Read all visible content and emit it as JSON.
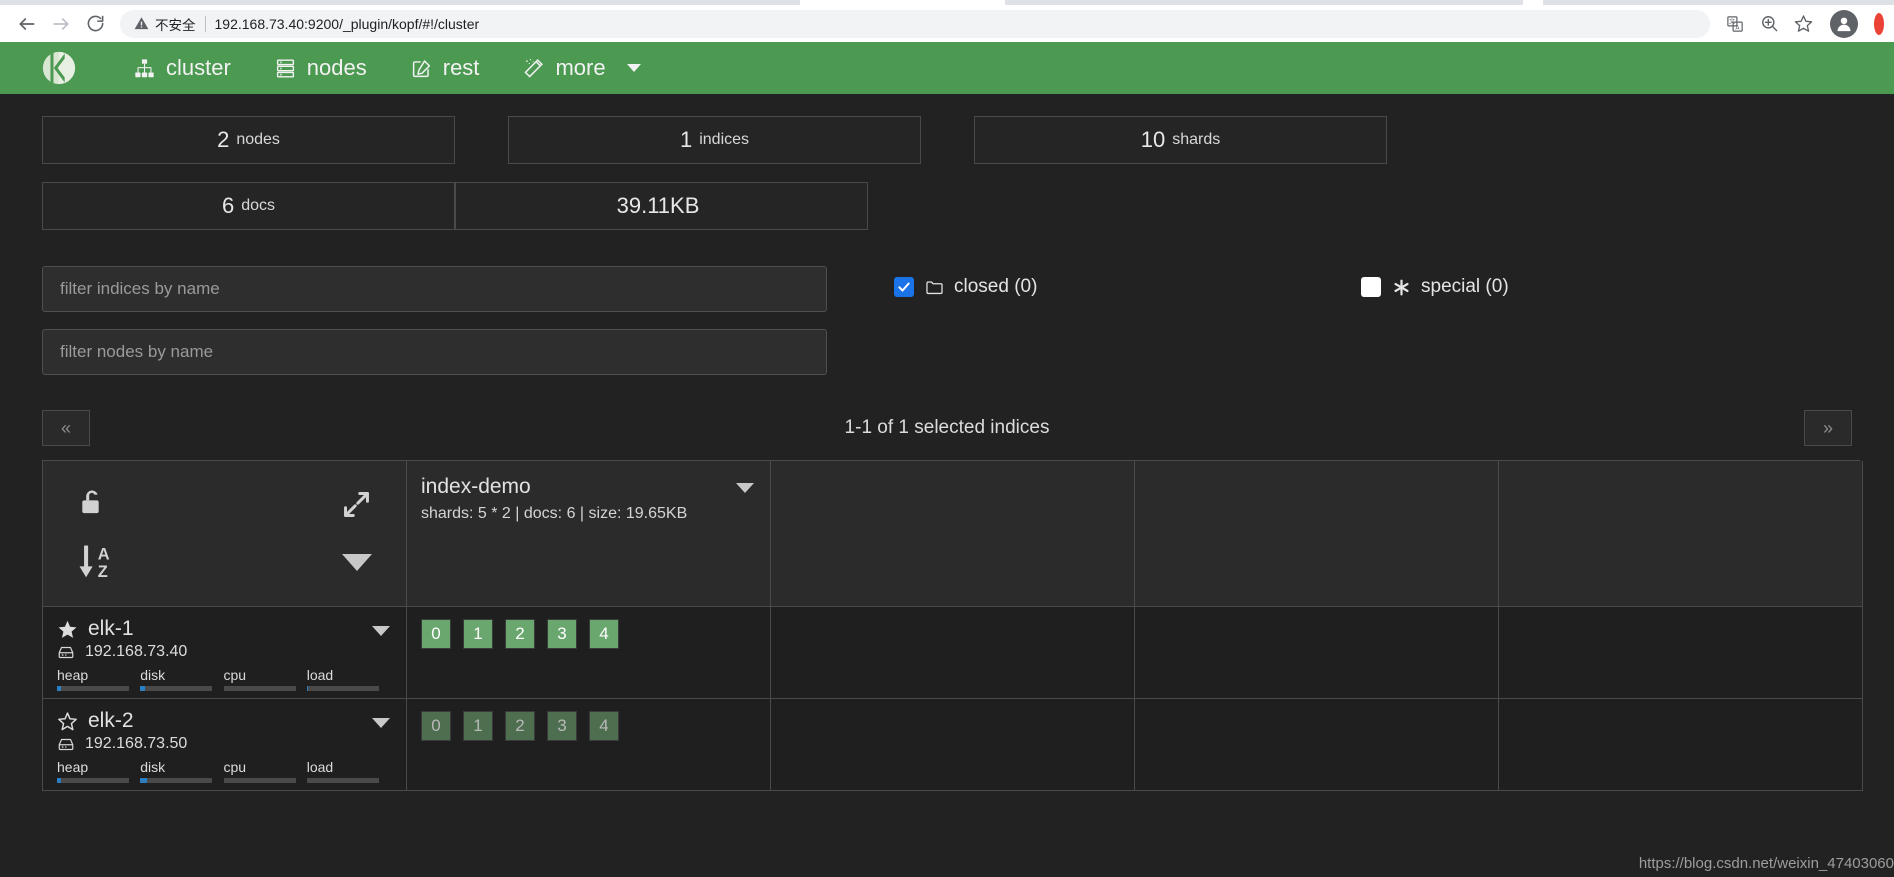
{
  "browser": {
    "back_icon": "back-arrow-icon",
    "forward_icon": "forward-arrow-icon",
    "reload_icon": "reload-icon",
    "security_label": "不安全",
    "url": "192.168.73.40:9200/_plugin/kopf/#!/cluster",
    "actions": [
      "translate-icon",
      "zoom-icon",
      "bookmark-star-icon",
      "profile-avatar-icon"
    ]
  },
  "app_nav": {
    "brand": "kopf-logo",
    "items": [
      {
        "label": "cluster",
        "icon": "sitemap-icon"
      },
      {
        "label": "nodes",
        "icon": "server-stack-icon"
      },
      {
        "label": "rest",
        "icon": "edit-square-icon"
      },
      {
        "label": "more",
        "icon": "magic-wand-icon",
        "caret": true
      }
    ]
  },
  "stats": [
    {
      "value": "2",
      "unit": "nodes"
    },
    {
      "value": "1",
      "unit": "indices"
    },
    {
      "value": "10",
      "unit": "shards"
    },
    {
      "value": "6",
      "unit": "docs"
    },
    {
      "value": "39.11KB",
      "unit": ""
    }
  ],
  "filters": {
    "indices_placeholder": "filter indices by name",
    "indices_value": "",
    "nodes_placeholder": "filter nodes by name",
    "nodes_value": "",
    "toggles": [
      {
        "label": "closed (0)",
        "checked": true,
        "icon": "folder-icon"
      },
      {
        "label": "special (0)",
        "checked": false,
        "icon": "asterisk-icon"
      }
    ]
  },
  "pager": {
    "prev": "«",
    "next": "»",
    "label": "1-1 of 1 selected indices"
  },
  "grid": {
    "controls": {
      "lock_icon": "unlock-icon",
      "expand_icon": "expand-arrows-icon",
      "sort_icon": "sort-alpha-asc-icon",
      "menu_icon": "caret-down-icon"
    },
    "indices": [
      {
        "name": "index-demo",
        "meta": "shards: 5 * 2 | docs: 6 | size: 19.65KB",
        "menu_icon": "caret-down-icon"
      }
    ],
    "empty_columns": 3,
    "nodes": [
      {
        "name": "elk-1",
        "ip": "192.168.73.40",
        "star": "star-filled-icon",
        "master": true,
        "menu_icon": "caret-down-icon",
        "metrics": [
          {
            "label": "heap",
            "percent": 6
          },
          {
            "label": "disk",
            "percent": 6
          },
          {
            "label": "cpu",
            "percent": 0
          },
          {
            "label": "load",
            "percent": 2
          }
        ],
        "shards": [
          {
            "label": "0",
            "type": "primary"
          },
          {
            "label": "1",
            "type": "primary"
          },
          {
            "label": "2",
            "type": "primary"
          },
          {
            "label": "3",
            "type": "primary"
          },
          {
            "label": "4",
            "type": "primary"
          }
        ]
      },
      {
        "name": "elk-2",
        "ip": "192.168.73.50",
        "star": "star-outline-icon",
        "master": false,
        "menu_icon": "caret-down-icon",
        "metrics": [
          {
            "label": "heap",
            "percent": 6
          },
          {
            "label": "disk",
            "percent": 9
          },
          {
            "label": "cpu",
            "percent": 0
          },
          {
            "label": "load",
            "percent": 0
          }
        ],
        "shards": [
          {
            "label": "0",
            "type": "replica"
          },
          {
            "label": "1",
            "type": "replica"
          },
          {
            "label": "2",
            "type": "replica"
          },
          {
            "label": "3",
            "type": "replica"
          },
          {
            "label": "4",
            "type": "replica"
          }
        ]
      }
    ]
  },
  "watermark": "https://blog.csdn.net/weixin_47403060",
  "colors": {
    "brand_green": "#4c9a52",
    "page_bg": "#222222",
    "accent_blue": "#1a73e8",
    "shard_primary": "#6aa76e",
    "shard_replica": "#4d6e4f",
    "meter_fill": "#2a7fc4"
  }
}
